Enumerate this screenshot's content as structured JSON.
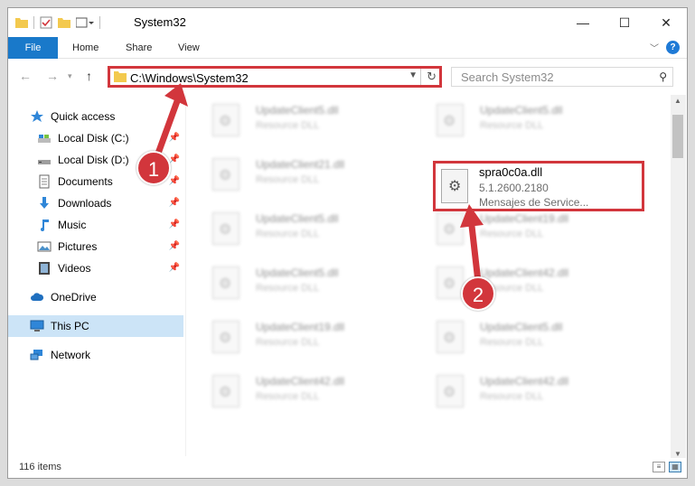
{
  "window": {
    "title": "System32",
    "controls": {
      "minimize": "—",
      "maximize": "☐",
      "close": "✕"
    }
  },
  "ribbon": {
    "tabs": [
      {
        "label": "File",
        "active": true
      },
      {
        "label": "Home",
        "active": false
      },
      {
        "label": "Share",
        "active": false
      },
      {
        "label": "View",
        "active": false
      }
    ],
    "help": "?"
  },
  "address": {
    "path": "C:\\Windows\\System32",
    "search_placeholder": "Search System32"
  },
  "navpane": {
    "items": [
      {
        "label": "Quick access",
        "icon": "star-icon",
        "pinned": false
      },
      {
        "label": "Local Disk (C:)",
        "icon": "drive-icon",
        "pinned": true
      },
      {
        "label": "Local Disk (D:)",
        "icon": "drive-icon",
        "pinned": true
      },
      {
        "label": "Documents",
        "icon": "documents-icon",
        "pinned": true
      },
      {
        "label": "Downloads",
        "icon": "download-icon",
        "pinned": true
      },
      {
        "label": "Music",
        "icon": "music-icon",
        "pinned": true
      },
      {
        "label": "Pictures",
        "icon": "pictures-icon",
        "pinned": true
      },
      {
        "label": "Videos",
        "icon": "videos-icon",
        "pinned": true
      },
      {
        "label": "OneDrive",
        "icon": "cloud-icon",
        "pinned": false
      },
      {
        "label": "This PC",
        "icon": "computer-icon",
        "pinned": false,
        "selected": true
      },
      {
        "label": "Network",
        "icon": "network-icon",
        "pinned": false
      }
    ]
  },
  "files": {
    "blurred": [
      {
        "name": "UpdateClient5.dll",
        "type": "Resource DLL"
      },
      {
        "name": "UpdateClient5.dll",
        "type": "Resource DLL"
      },
      {
        "name": "UpdateClient21.dll",
        "type": "Resource DLL"
      },
      {
        "name": "UpdateClient5.dll",
        "type": "Resource DLL"
      },
      {
        "name": "UpdateClient19.dll",
        "type": "Resource DLL"
      },
      {
        "name": "UpdateClient5.dll",
        "type": "Resource DLL"
      },
      {
        "name": "UpdateClient42.dll",
        "type": "Resource DLL"
      },
      {
        "name": "UpdateClient19.dll",
        "type": "Resource DLL"
      },
      {
        "name": "UpdateClient5.dll",
        "type": "Resource DLL"
      },
      {
        "name": "UpdateClient42.dll",
        "type": "Resource DLL"
      },
      {
        "name": "UpdateClient42.dll",
        "type": "Resource DLL"
      }
    ],
    "highlighted": {
      "name": "spra0c0a.dll",
      "version": "5.1.2600.2180",
      "description": "Mensajes de Service..."
    }
  },
  "status": {
    "item_count": "116 items"
  },
  "annotations": {
    "step1": "1",
    "step2": "2",
    "color": "#d2363c"
  }
}
